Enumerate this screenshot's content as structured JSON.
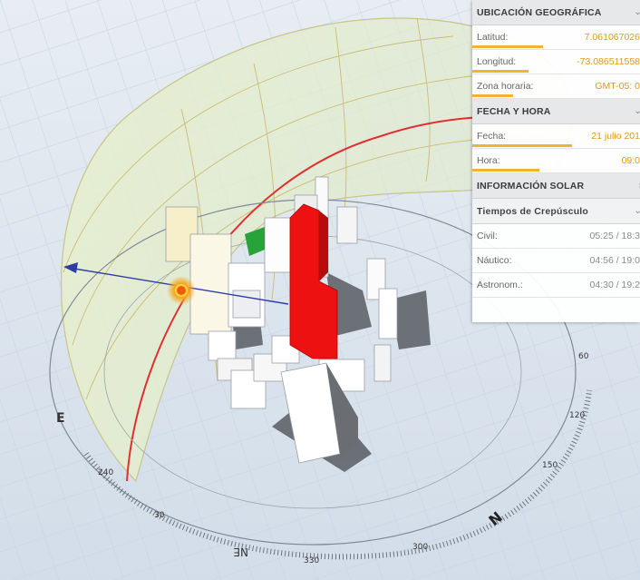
{
  "panel": {
    "location": {
      "title": "UBICACIÓN GEOGRÁFICA",
      "latitude_label": "Latitud:",
      "latitude_value": "7.061067026",
      "longitude_label": "Longitud:",
      "longitude_value": "-73.086511558",
      "timezone_label": "Zona horaria:",
      "timezone_value": "GMT-05: 0"
    },
    "datetime": {
      "title": "FECHA Y HORA",
      "date_label": "Fecha:",
      "date_value": "21 julio 201",
      "time_label": "Hora:",
      "time_value": "09:0"
    },
    "solar": {
      "title": "INFORMACIÓN SOLAR",
      "twilight_title": "Tiempos de Crepúsculo",
      "rows": [
        {
          "label": "Civil:",
          "value": "05:25 / 18:3"
        },
        {
          "label": "Náutico:",
          "value": "04:56 / 19:0"
        },
        {
          "label": "Astronom.:",
          "value": "04:30 / 19:2"
        }
      ]
    }
  },
  "compass": {
    "labels": [
      "E",
      "N",
      "NE",
      "NE",
      "N",
      "30",
      "330",
      "300",
      "150",
      "120",
      "60",
      "240"
    ]
  },
  "colors": {
    "highlight_building": "#ee1111",
    "sun": "#f5a623",
    "sun_path": "#e03030",
    "accent_bar": "#f2b233"
  }
}
